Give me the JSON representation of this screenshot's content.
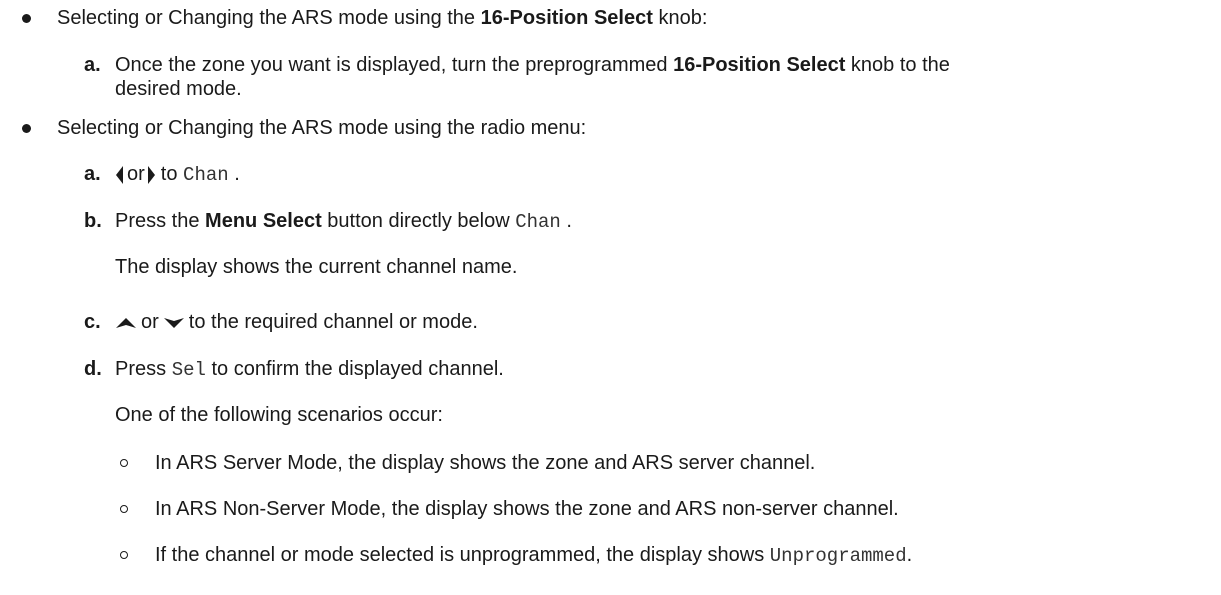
{
  "items": {
    "knob": {
      "pre": "Selecting or Changing the ARS mode using the ",
      "bold": "16-Position Select",
      "post": " knob:",
      "steps": {
        "a": {
          "marker": "a.",
          "pre": "Once the zone you want is displayed, turn the preprogrammed ",
          "bold": "16-Position Select",
          "post": " knob to the",
          "line2": "desired mode."
        }
      }
    },
    "menu": {
      "text": "Selecting or Changing the ARS mode using the radio menu:",
      "steps": {
        "a": {
          "marker": "a.",
          "or": "or",
          "to": "to",
          "code": "Chan",
          "end": "."
        },
        "b": {
          "marker": "b.",
          "pre": "Press the ",
          "bold": "Menu Select",
          "mid": " button directly below ",
          "code": "Chan",
          "end": ".",
          "result": "The display shows the current channel name."
        },
        "c": {
          "marker": "c.",
          "or": "or",
          "post": "to the required channel or mode."
        },
        "d": {
          "marker": "d.",
          "pre": "Press ",
          "code": "Sel",
          "post": " to confirm the displayed channel.",
          "result": "One of the following scenarios occur:"
        }
      },
      "scenarios": [
        {
          "text": "In ARS Server Mode, the display shows the zone and ARS server channel."
        },
        {
          "text": "In ARS Non-Server Mode, the display shows the zone and ARS non-server channel."
        },
        {
          "pre": "If the channel or mode selected is unprogrammed, the display shows ",
          "code": "Unprogrammed",
          "end": "."
        }
      ]
    }
  },
  "icons": [
    "left-arrow-icon",
    "right-arrow-icon",
    "up-arrow-icon",
    "down-arrow-icon"
  ]
}
